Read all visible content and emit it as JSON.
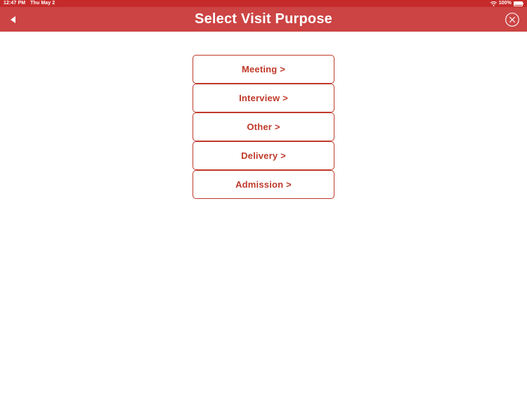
{
  "status_bar": {
    "time": "12:47 PM",
    "date": "Thu May 2",
    "wifi_icon": "wifi-icon",
    "battery_percent": "100%",
    "battery_icon": "battery-full-icon",
    "background_color": "#c62b2b",
    "text_color": "#ffffff"
  },
  "nav_bar": {
    "title": "Select Visit Purpose",
    "back_icon": "back-triangle-icon",
    "close_icon": "close-circle-icon",
    "background_color": "#cc4444",
    "title_color": "#ffffff"
  },
  "main": {
    "accent_color": "#c0392b",
    "background_color": "#ffffff",
    "purpose_options": [
      {
        "label": "Meeting >",
        "name": "meeting"
      },
      {
        "label": "Interview >",
        "name": "interview"
      },
      {
        "label": "Other >",
        "name": "other"
      },
      {
        "label": "Delivery >",
        "name": "delivery"
      },
      {
        "label": "Admission >",
        "name": "admission"
      }
    ]
  }
}
